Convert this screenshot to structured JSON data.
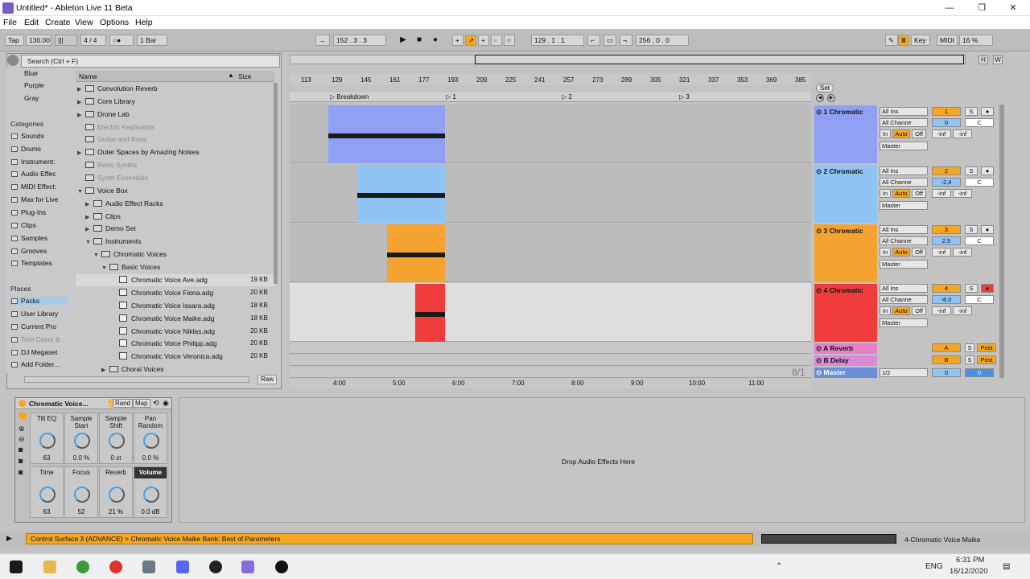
{
  "window": {
    "title": "Untitled* - Ableton Live 11 Beta"
  },
  "menu": [
    "File",
    "Edit",
    "Create",
    "View",
    "Options",
    "Help"
  ],
  "controlbar": {
    "tap": "Tap",
    "tempo": "130.00",
    "signature": "4 / 4",
    "metro": "○●",
    "quantize": "1 Bar",
    "position": "152 . 3 . 3",
    "loop_start": "129 . 1 . 1",
    "loop_length": "256 . 0 . 0",
    "key": "Key",
    "midi": "MIDI",
    "cpu": "16 %"
  },
  "browser": {
    "search_placeholder": "Search (Ctrl + F)",
    "colors": [
      "Blue",
      "Purple",
      "Gray"
    ],
    "categories_title": "Categories",
    "categories": [
      "Sounds",
      "Drums",
      "Instrument:",
      "Audio Effec",
      "MIDI Effect:",
      "Max for Live",
      "Plug-Ins",
      "Clips",
      "Samples",
      "Grooves",
      "Templates"
    ],
    "places_title": "Places",
    "places": [
      "Packs",
      "User Library",
      "Current Pro",
      "Tom Cosm &",
      "DJ Megaset",
      "Add Folder..."
    ],
    "col_name": "Name",
    "col_size": "Size",
    "tree": [
      {
        "label": "Convolution Reverb",
        "dim": false
      },
      {
        "label": "Core Library",
        "dim": false
      },
      {
        "label": "Drone Lab",
        "dim": false
      },
      {
        "label": "Electric Keyboards",
        "dim": true
      },
      {
        "label": "Guitar and Bass",
        "dim": true
      },
      {
        "label": "Outer Spaces by Amazing Noises",
        "dim": false
      },
      {
        "label": "Retro Synths",
        "dim": true
      },
      {
        "label": "Synth Essentials",
        "dim": true
      },
      {
        "label": "Voice Box",
        "dim": false
      },
      {
        "label": "Audio Effect Racks",
        "dim": false
      },
      {
        "label": "Clips",
        "dim": false
      },
      {
        "label": "Demo Set",
        "dim": false
      },
      {
        "label": "Instruments",
        "dim": false
      },
      {
        "label": "Chromatic Voices",
        "dim": false
      },
      {
        "label": "Basic Voices",
        "dim": false
      },
      {
        "label": "Chromatic Voice Ave.adg",
        "size": "19 KB"
      },
      {
        "label": "Chromatic Voice Fiona.adg",
        "size": "20 KB"
      },
      {
        "label": "Chromatic Voice Issara.adg",
        "size": "18 KB"
      },
      {
        "label": "Chromatic Voice Maike.adg",
        "size": "18 KB"
      },
      {
        "label": "Chromatic Voice Niklas.adg",
        "size": "20 KB"
      },
      {
        "label": "Chromatic Voice Philipp.adg",
        "size": "20 KB"
      },
      {
        "label": "Chromatic Voice Veronica.adg",
        "size": "20 KB"
      },
      {
        "label": "Choral Voices",
        "dim": false
      }
    ],
    "raw": "Raw"
  },
  "arrangement": {
    "bars": [
      "113",
      "129",
      "145",
      "161",
      "177",
      "193",
      "209",
      "225",
      "241",
      "257",
      "273",
      "289",
      "305",
      "321",
      "337",
      "353",
      "369",
      "385"
    ],
    "locators": [
      "Breakdown",
      "1",
      "2",
      "3"
    ],
    "set": "Set",
    "times": [
      "4:00",
      "5:00",
      "6:00",
      "7:00",
      "8:00",
      "9:00",
      "10:00",
      "11:00"
    ],
    "zoom": "8/1"
  },
  "tracks": [
    {
      "name": "1 Chromatic",
      "color": "#8fa0f5",
      "input": "All Ins",
      "channel": "All Channe",
      "num": "1",
      "vol": "0",
      "pan": "C",
      "out": "Master"
    },
    {
      "name": "2 Chromatic",
      "color": "#8fc4f5",
      "input": "All Ins",
      "channel": "All Channe",
      "num": "2",
      "vol": "-2.4",
      "pan": "C",
      "out": "Master"
    },
    {
      "name": "3 Chromatic",
      "color": "#f5a330",
      "input": "All Ins",
      "channel": "All Channe",
      "num": "3",
      "vol": "2.5",
      "pan": "C",
      "out": "Master"
    },
    {
      "name": "4 Chromatic",
      "color": "#f03c3c",
      "input": "All Ins",
      "channel": "All Channe",
      "num": "4",
      "vol": "-8.0",
      "pan": "C",
      "out": "Master"
    }
  ],
  "returns": [
    {
      "name": "A Reverb",
      "letter": "A",
      "post": "Post",
      "color": "#e87dc8"
    },
    {
      "name": "B Delay",
      "letter": "B",
      "post": "Post",
      "color": "#d88ad8"
    },
    {
      "name": "Master",
      "letter": "0",
      "post": "0",
      "color": "#6a8fd8",
      "out": "1/2"
    }
  ],
  "mixer_labels": {
    "in": "In",
    "auto": "Auto",
    "off": "Off",
    "inf": "-inf",
    "s": "S"
  },
  "device": {
    "title": "Chromatic Voice...",
    "rand": "Rand",
    "map": "Map",
    "macros": [
      {
        "label": "Tilt EQ",
        "value": "63"
      },
      {
        "label": "Sample Start",
        "value": "0.0 %"
      },
      {
        "label": "Sample Shift",
        "value": "0 st"
      },
      {
        "label": "Pan Random",
        "value": "0.0 %"
      },
      {
        "label": "Time",
        "value": "63"
      },
      {
        "label": "Focus",
        "value": "52"
      },
      {
        "label": "Reverb",
        "value": "21 %"
      },
      {
        "label": "Volume",
        "value": "0.0 dB"
      }
    ]
  },
  "dropzone": "Drop Audio Effects Here",
  "status": {
    "message": "Control Surface 3 (ADVANCE) > Chromatic Voice Maike Bank: Best of Parameters",
    "track": "4-Chromatic Voice Maike"
  },
  "taskbar": {
    "lang": "ENG",
    "time": "6:31 PM",
    "date": "16/12/2020"
  }
}
